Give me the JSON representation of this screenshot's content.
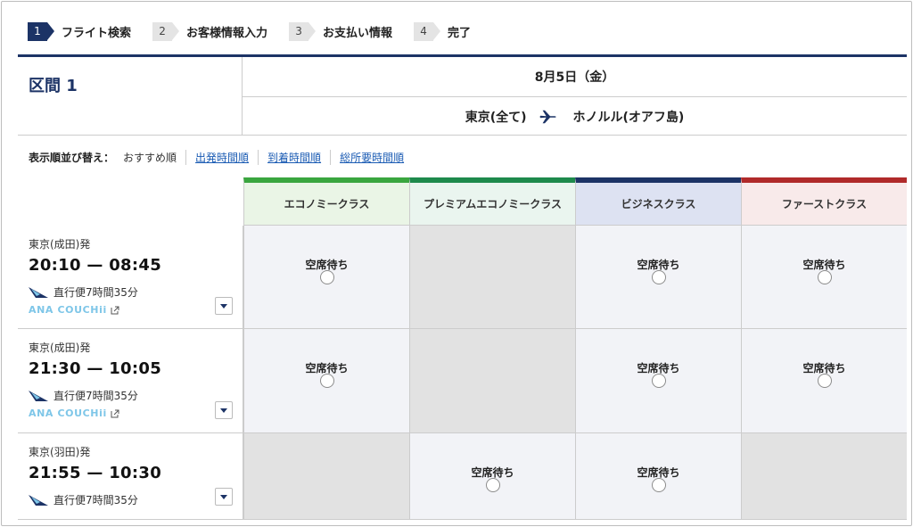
{
  "steps": [
    {
      "num": "1",
      "label": "フライト検索"
    },
    {
      "num": "2",
      "label": "お客様情報入力"
    },
    {
      "num": "3",
      "label": "お支払い情報"
    },
    {
      "num": "4",
      "label": "完了"
    }
  ],
  "segment": {
    "title": "区間 1",
    "date": "8月5日（金）",
    "origin": "東京(全て)",
    "destination": "ホノルル(オアフ島)"
  },
  "sort": {
    "label": "表示順並び替え：",
    "current": "おすすめ順",
    "options": [
      "出発時間順",
      "到着時間順",
      "総所要時間順"
    ]
  },
  "classes": [
    {
      "label": "エコノミークラス",
      "color": "#3aa63f",
      "bg": "#eaf5e6"
    },
    {
      "label": "プレミアムエコノミークラス",
      "color": "#1e8a4c",
      "bg": "#eaf5ef"
    },
    {
      "label": "ビジネスクラス",
      "color": "#1c3366",
      "bg": "#dde2f2"
    },
    {
      "label": "ファーストクラス",
      "color": "#b02a2a",
      "bg": "#f8eaea"
    }
  ],
  "flights": [
    {
      "departure_airport": "東京(成田)発",
      "times": "20:10 — 08:45",
      "duration": "直行便7時間35分",
      "promo": "ANA COUCHii",
      "cells": [
        {
          "status": "空席待ち"
        },
        {
          "status": ""
        },
        {
          "status": "空席待ち"
        },
        {
          "status": "空席待ち"
        }
      ]
    },
    {
      "departure_airport": "東京(成田)発",
      "times": "21:30 — 10:05",
      "duration": "直行便7時間35分",
      "promo": "ANA COUCHii",
      "cells": [
        {
          "status": "空席待ち"
        },
        {
          "status": ""
        },
        {
          "status": "空席待ち"
        },
        {
          "status": "空席待ち"
        }
      ]
    },
    {
      "departure_airport": "東京(羽田)発",
      "times": "21:55 — 10:30",
      "duration": "直行便7時間35分",
      "promo": "",
      "cells": [
        {
          "status": ""
        },
        {
          "status": "空席待ち"
        },
        {
          "status": "空席待ち"
        },
        {
          "status": ""
        }
      ]
    }
  ]
}
